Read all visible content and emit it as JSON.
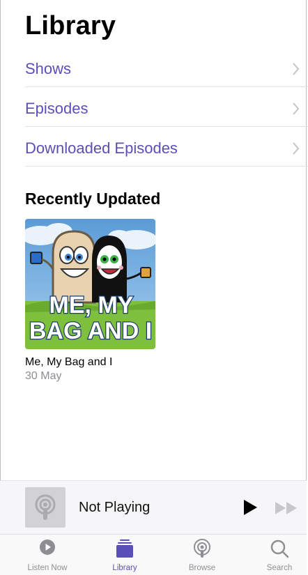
{
  "header": {
    "title": "Library"
  },
  "library_rows": [
    {
      "label": "Shows"
    },
    {
      "label": "Episodes"
    },
    {
      "label": "Downloaded Episodes"
    }
  ],
  "recently_updated": {
    "heading": "Recently Updated",
    "items": [
      {
        "title": "Me, My Bag and I",
        "date": "30 May",
        "artwork_text_line1": "ME, MY",
        "artwork_text_line2": "BAG AND I"
      }
    ]
  },
  "mini_player": {
    "status": "Not Playing",
    "play_icon": "play-icon",
    "forward_icon": "fast-forward-icon"
  },
  "tabbar": {
    "active": "Library",
    "tabs": [
      {
        "label": "Listen Now",
        "icon": "play-circle-icon"
      },
      {
        "label": "Library",
        "icon": "library-stack-icon"
      },
      {
        "label": "Browse",
        "icon": "podcast-icon"
      },
      {
        "label": "Search",
        "icon": "search-icon"
      }
    ]
  },
  "colors": {
    "accent": "#5a4fb8",
    "secondary_text": "#8e8e93",
    "separator": "#e1e1e6"
  }
}
